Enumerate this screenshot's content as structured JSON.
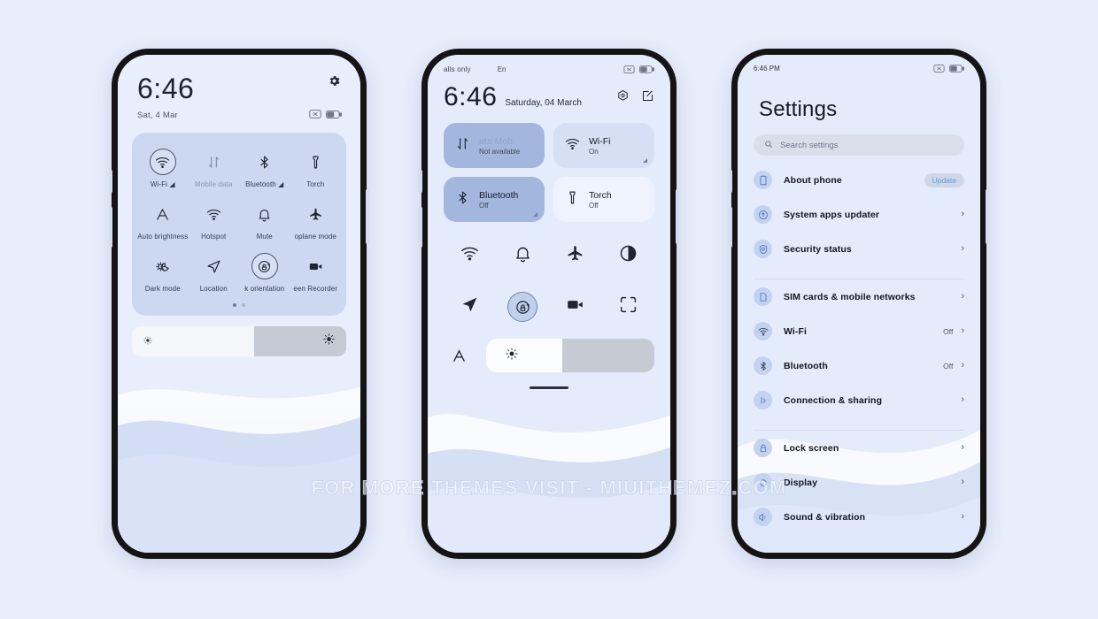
{
  "watermark": "FOR MORE THEMES VISIT - MIUITHEMEZ.COM",
  "phone1": {
    "time": "6:46",
    "date": "Sat, 4 Mar",
    "tiles": [
      {
        "label": "Wi-Fi ◢",
        "icon": "wifi-icon",
        "state": "on"
      },
      {
        "label": "Mobile data",
        "icon": "mobile-data-icon",
        "state": "dim"
      },
      {
        "label": "Bluetooth ◢",
        "icon": "bluetooth-icon",
        "state": "off"
      },
      {
        "label": "Torch",
        "icon": "torch-icon",
        "state": "off"
      },
      {
        "label": "Auto brightness",
        "icon": "auto-brightness-icon",
        "state": "off"
      },
      {
        "label": "Hotspot",
        "icon": "hotspot-icon",
        "state": "off"
      },
      {
        "label": "Mute",
        "icon": "mute-bell-icon",
        "state": "off"
      },
      {
        "label": "oplane mode",
        "icon": "airplane-icon",
        "state": "off"
      },
      {
        "label": "Dark mode",
        "icon": "dark-mode-icon",
        "state": "off"
      },
      {
        "label": "Location",
        "icon": "location-icon",
        "state": "off"
      },
      {
        "label": "k orientation",
        "icon": "lock-orientation-icon",
        "state": "on"
      },
      {
        "label": "een Recorder",
        "icon": "screen-recorder-icon",
        "state": "off"
      }
    ],
    "page_dots": 2,
    "active_dot": 0,
    "brightness_percent": 57
  },
  "phone2": {
    "status_carrier": "alls only",
    "status_lang": "En",
    "time": "6:46",
    "date": "Saturday, 04 March",
    "big_tiles": [
      {
        "title": "ata      Mob",
        "subtitle": "Not available",
        "icon": "mobile-data-icon",
        "style": "on",
        "corner": false
      },
      {
        "title": "Wi-Fi",
        "subtitle": "On",
        "icon": "wifi-icon",
        "style": "off",
        "corner": true
      },
      {
        "title": "Bluetooth",
        "subtitle": "Off",
        "icon": "bluetooth-icon",
        "style": "on",
        "corner": true
      },
      {
        "title": "Torch",
        "subtitle": "Off",
        "icon": "torch-icon",
        "style": "plain",
        "corner": false
      }
    ],
    "mini_tiles": [
      {
        "icon": "hotspot-icon",
        "active": false
      },
      {
        "icon": "mute-bell-icon",
        "active": false
      },
      {
        "icon": "airplane-icon",
        "active": false
      },
      {
        "icon": "dark-mode-contrast-icon",
        "active": false
      },
      {
        "icon": "location-icon",
        "active": false
      },
      {
        "icon": "lock-orientation-icon",
        "active": true
      },
      {
        "icon": "screen-recorder-icon",
        "active": false
      },
      {
        "icon": "screenshot-icon",
        "active": false
      }
    ],
    "brightness_percent": 45,
    "font_label": "A"
  },
  "phone3": {
    "status_time": "6:46 PM",
    "title": "Settings",
    "search_placeholder": "Search settings",
    "groups": [
      {
        "items": [
          {
            "label": "About phone",
            "icon": "phone-icon",
            "badge": "Update",
            "value": "",
            "chevron": false
          },
          {
            "label": "System apps updater",
            "icon": "updater-icon",
            "badge": "",
            "value": "",
            "chevron": true
          },
          {
            "label": "Security status",
            "icon": "security-icon",
            "badge": "",
            "value": "",
            "chevron": true
          }
        ]
      },
      {
        "items": [
          {
            "label": "SIM cards & mobile networks",
            "icon": "sim-card-icon",
            "badge": "",
            "value": "",
            "chevron": true
          },
          {
            "label": "Wi-Fi",
            "icon": "wifi-icon",
            "badge": "",
            "value": "Off",
            "chevron": true
          },
          {
            "label": "Bluetooth",
            "icon": "bluetooth-icon",
            "badge": "",
            "value": "Off",
            "chevron": true
          },
          {
            "label": "Connection & sharing",
            "icon": "connection-sharing-icon",
            "badge": "",
            "value": "",
            "chevron": true
          }
        ]
      },
      {
        "items": [
          {
            "label": "Lock screen",
            "icon": "lock-screen-icon",
            "badge": "",
            "value": "",
            "chevron": true
          },
          {
            "label": "Display",
            "icon": "display-icon",
            "badge": "",
            "value": "",
            "chevron": true
          },
          {
            "label": "Sound & vibration",
            "icon": "sound-vibration-icon",
            "badge": "",
            "value": "",
            "chevron": true
          }
        ]
      }
    ]
  },
  "colors": {
    "page_background": "#e8edfc",
    "screen_background": "#e4ecfc",
    "tile_card": "#ccd8f0",
    "tile_active": "#a3b6dd",
    "tile_inactive": "#d5e0f5",
    "accent_badge_text": "#5e9ae0",
    "frame": "#141414"
  }
}
